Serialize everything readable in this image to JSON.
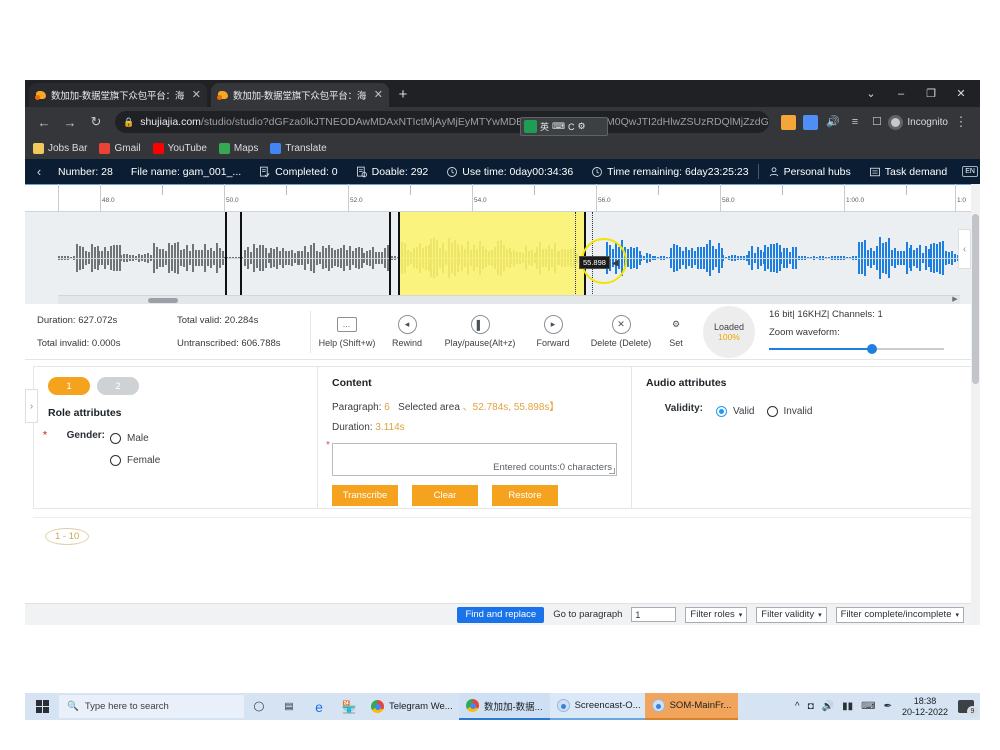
{
  "browser": {
    "tabs": [
      {
        "title": "数加加-数据堂旗下众包平台：海",
        "active": false
      },
      {
        "title": "数加加-数据堂旗下众包平台：海",
        "active": true
      }
    ],
    "new_tab_label": "+",
    "window_controls": {
      "minimize": "–",
      "maximize": "❐",
      "close": "✕",
      "chevron": "⌄"
    },
    "nav": {
      "back": "←",
      "forward": "→",
      "reload": "↻"
    },
    "omnibox": {
      "lock_icon": "lock-icon",
      "host": "shujiajia.com",
      "path": "/studio/studio?dGFza0lkJTNEODAwMDAxNTIctMjAyMjEyMTYwMDE5MCUyNnJvbGUlM0QwJTI2dHlwZSUzRDQlMjZzdGF0dXM...",
      "star_icon": "☆"
    },
    "extensions": [
      "extension-orange",
      "extension-blue",
      "volume-icon",
      "list-icon",
      "window-icon"
    ],
    "profile": {
      "label": "Incognito"
    },
    "popup": {
      "icons": [
        "translate-box",
        "keyboard",
        "C",
        "gear"
      ]
    },
    "bookmarks": [
      {
        "label": "Jobs Bar",
        "color": "#f2c85b"
      },
      {
        "label": "Gmail",
        "color": "#ea4335"
      },
      {
        "label": "YouTube",
        "color": "#ff0000"
      },
      {
        "label": "Maps",
        "color": "#34a853"
      },
      {
        "label": "Translate",
        "color": "#4285f4"
      }
    ]
  },
  "appbar": {
    "collapse_icon": "‹",
    "items": [
      {
        "label": "Number: 28",
        "icon": null
      },
      {
        "label": "File name: gam_001_...",
        "icon": null
      },
      {
        "label": "Completed: 0",
        "icon": "document-check-icon"
      },
      {
        "label": "Doable: 292",
        "icon": "document-clock-icon"
      },
      {
        "label": "Use time: 0day00:34:36",
        "icon": "clock-icon"
      },
      {
        "label": "Time remaining: 6day23:25:23",
        "icon": "clock-icon"
      }
    ],
    "right_items": [
      {
        "label": "Personal hubs",
        "icon": "user-icon"
      },
      {
        "label": "Task demand",
        "icon": "list-icon"
      }
    ],
    "lang_badge": "EN"
  },
  "waveform": {
    "ruler_labels": [
      "48.0",
      "50.0",
      "52.0",
      "54.0",
      "56.0",
      "58.0",
      "1:00.0",
      "1:0"
    ],
    "cursor_tooltip": "55.898",
    "selection": {
      "start": "52.784s",
      "end": "55.898s"
    }
  },
  "stats": {
    "duration_label": "Duration:",
    "duration_value": "627.072s",
    "total_valid_label": "Total valid:",
    "total_valid_value": "20.284s",
    "total_invalid_label": "Total invalid:",
    "total_invalid_value": "0.000s",
    "untranscribed_label": "Untranscribed:",
    "untranscribed_value": "606.788s"
  },
  "transport": [
    {
      "label": "Help (Shift+w)",
      "icon": "keyboard-icon",
      "glyph": "⌨"
    },
    {
      "label": "Rewind",
      "icon": "rewind-icon",
      "glyph": "◂"
    },
    {
      "label": "Play/pause(Alt+z)",
      "icon": "play-pause-icon",
      "glyph": "▮"
    },
    {
      "label": "Forward",
      "icon": "forward-icon",
      "glyph": "▸"
    },
    {
      "label": "Delete (Delete)",
      "icon": "close-icon",
      "glyph": "✕"
    },
    {
      "label": "Set",
      "icon": "gear-icon",
      "glyph": "⚙"
    }
  ],
  "loaded": {
    "label": "Loaded",
    "percent": "100%"
  },
  "audio_meta": {
    "format": "16 bit| 16KHZ| Channels: 1",
    "zoom_label": "Zoom waveform:"
  },
  "role_panel": {
    "tabs": [
      {
        "label": "1",
        "active": true
      },
      {
        "label": "2",
        "active": false
      }
    ],
    "title": "Role attributes",
    "gender_label": "Gender:",
    "gender_required": "*",
    "options": [
      {
        "label": "Male",
        "selected": false
      },
      {
        "label": "Female",
        "selected": false
      }
    ]
  },
  "content_panel": {
    "title": "Content",
    "paragraph_label": "Paragraph:",
    "paragraph_value": "6",
    "selected_area_label": "Selected area",
    "selected_area_value": "、52.784s,   55.898s】",
    "duration_label": "Duration:",
    "duration_value": "3.114s",
    "textarea_value": "",
    "counter": "Entered counts:0 characters",
    "buttons": [
      "Transcribe",
      "Clear",
      "Restore"
    ]
  },
  "audio_panel": {
    "title": "Audio attributes",
    "validity_label": "Validity:",
    "options": [
      {
        "label": "Valid",
        "selected": true
      },
      {
        "label": "Invalid",
        "selected": false
      }
    ]
  },
  "paragraph_strip": {
    "badge": "1 - 10"
  },
  "bottom_bar": {
    "find_replace": "Find and replace",
    "goto_label": "Go to paragraph",
    "goto_value": "1",
    "filters": [
      "Filter roles",
      "Filter validity",
      "Filter complete/incomplete"
    ],
    "caret": "▾"
  },
  "taskbar": {
    "search_placeholder": "Type here to search",
    "search_icon": "magnifier-icon",
    "quick_icons": [
      "task-view-circle",
      "task-view-icon",
      "edge-icon",
      "store-icon"
    ],
    "apps": [
      {
        "label": "Telegram We...",
        "type": "chrome"
      },
      {
        "label": "数加加-数据...",
        "type": "chrome-active"
      },
      {
        "label": "Screencast-O...",
        "type": "light"
      },
      {
        "label": "SOM-MainFr...",
        "type": "orange"
      }
    ],
    "tray_icons": [
      "chevron-up-icon",
      "wifi-icon",
      "volume-icon",
      "battery-icon",
      "keyboard-icon",
      "pen-icon"
    ],
    "time": "18:38",
    "date": "20-12-2022",
    "notification_count": "9"
  }
}
